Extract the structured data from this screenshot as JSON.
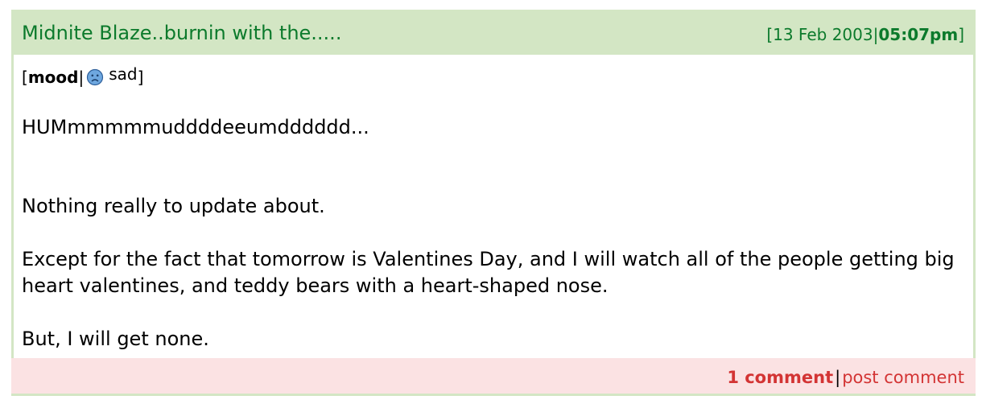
{
  "entry": {
    "title": "Midnite Blaze..burnin with the.....",
    "date": "13 Feb 2003",
    "time": "05:07pm"
  },
  "mood": {
    "label": "mood",
    "value": "sad",
    "icon": "sad-face-icon"
  },
  "body": {
    "paragraphs": [
      "HUMmmmmmuddddeeumdddddd...",
      "Nothing really to update about.",
      "Except for the fact that tomorrow is Valentines Day, and I will watch all of the people getting big heart valentines, and teddy bears with a heart-shaped nose.",
      "But, I will get none."
    ]
  },
  "footer": {
    "comments_link": "1 comment",
    "post_link": "post comment"
  },
  "colors": {
    "header_bg": "#d3e6c4",
    "title_green": "#0c7a2c",
    "footer_bg": "#fbe2e3",
    "link_red": "#d33434"
  }
}
